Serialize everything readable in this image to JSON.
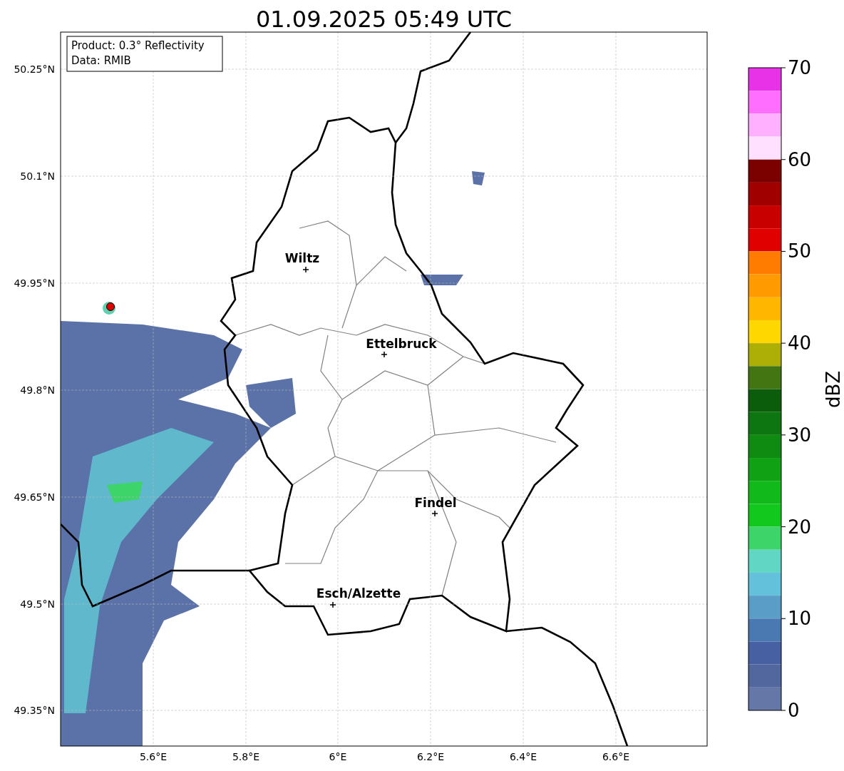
{
  "title": "01.09.2025 05:49 UTC",
  "legend": {
    "lines": [
      "Product: 0.3° Reflectivity",
      "Data: RMIB"
    ]
  },
  "yticks": [
    "50.25°N",
    "50.1°N",
    "49.95°N",
    "49.8°N",
    "49.65°N",
    "49.5°N",
    "49.35°N"
  ],
  "xticks": [
    "5.6°E",
    "5.8°E",
    "6°E",
    "6.2°E",
    "6.4°E",
    "6.6°E"
  ],
  "places": [
    {
      "name": "Wiltz"
    },
    {
      "name": "Ettelbruck"
    },
    {
      "name": "Findel"
    },
    {
      "name": "Esch/Alzette"
    }
  ],
  "colorbar": {
    "label": "dBZ",
    "ticks": [
      "70",
      "60",
      "50",
      "40",
      "30",
      "20",
      "10",
      "0"
    ],
    "segments": [
      {
        "color": "#e832e8"
      },
      {
        "color": "#ff6eff"
      },
      {
        "color": "#ffb0ff"
      },
      {
        "color": "#ffe0ff"
      },
      {
        "color": "#7b0000"
      },
      {
        "color": "#a00000"
      },
      {
        "color": "#c80000"
      },
      {
        "color": "#e00000"
      },
      {
        "color": "#ff7c00"
      },
      {
        "color": "#ff9a00"
      },
      {
        "color": "#ffb600"
      },
      {
        "color": "#ffd700"
      },
      {
        "color": "#aeaf06"
      },
      {
        "color": "#437612"
      },
      {
        "color": "#0b5c0b"
      },
      {
        "color": "#0d7610"
      },
      {
        "color": "#0f8b12"
      },
      {
        "color": "#10a115"
      },
      {
        "color": "#12b91a"
      },
      {
        "color": "#13c81d"
      },
      {
        "color": "#3dd46a"
      },
      {
        "color": "#62d6c4"
      },
      {
        "color": "#63c1dc"
      },
      {
        "color": "#5a9dc7"
      },
      {
        "color": "#4a79b1"
      },
      {
        "color": "#4660a2"
      },
      {
        "color": "#53679f"
      },
      {
        "color": "#6577a6"
      }
    ]
  }
}
